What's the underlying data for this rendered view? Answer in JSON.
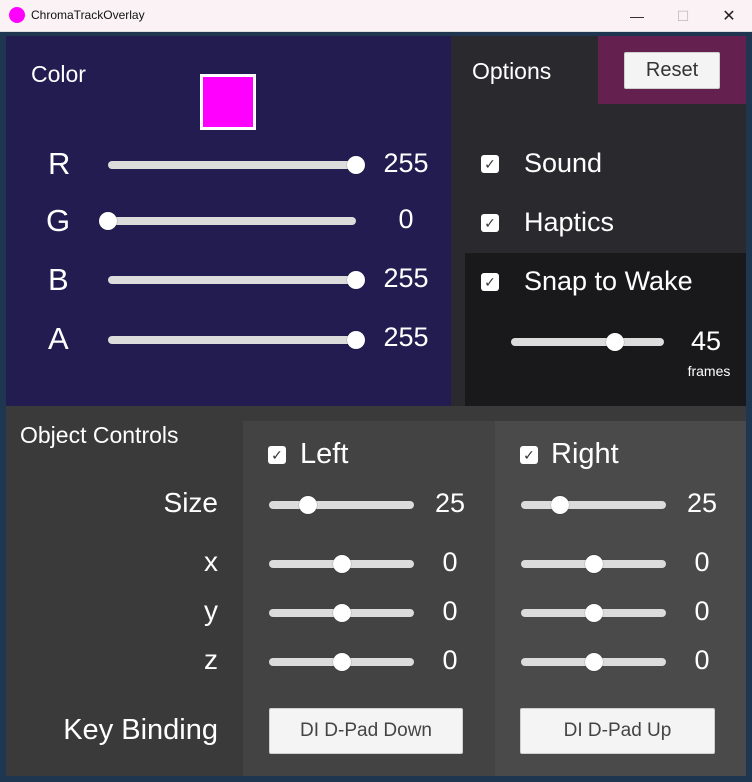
{
  "window": {
    "title": "ChromaTrackOverlay",
    "min_glyph": "—",
    "max_glyph": "☐",
    "close_glyph": "✕",
    "accent": "#ff00ff"
  },
  "color_panel": {
    "heading": "Color",
    "swatch_color": "#ff00ff",
    "channels": [
      {
        "label": "R",
        "value": "255",
        "level": 1.0
      },
      {
        "label": "G",
        "value": "0",
        "level": 0.0
      },
      {
        "label": "B",
        "value": "255",
        "level": 1.0
      },
      {
        "label": "A",
        "value": "255",
        "level": 1.0
      }
    ]
  },
  "options_panel": {
    "heading": "Options",
    "reset_label": "Reset",
    "check_glyph": "✓",
    "sound": {
      "label": "Sound",
      "checked": true
    },
    "haptics": {
      "label": "Haptics",
      "checked": true
    },
    "snap": {
      "label": "Snap to Wake",
      "checked": true,
      "value": "45",
      "unit": "frames",
      "level": 0.68
    }
  },
  "object_controls": {
    "heading": "Object Controls",
    "row_labels": {
      "size": "Size",
      "x": "x",
      "y": "y",
      "z": "z",
      "key_binding": "Key Binding"
    },
    "left": {
      "label": "Left",
      "checked": true,
      "size": {
        "value": "25",
        "level": 0.27
      },
      "x": {
        "value": "0",
        "level": 0.5
      },
      "y": {
        "value": "0",
        "level": 0.5
      },
      "z": {
        "value": "0",
        "level": 0.5
      },
      "binding": "DI D-Pad Down"
    },
    "right": {
      "label": "Right",
      "checked": true,
      "size": {
        "value": "25",
        "level": 0.27
      },
      "x": {
        "value": "0",
        "level": 0.5
      },
      "y": {
        "value": "0",
        "level": 0.5
      },
      "z": {
        "value": "0",
        "level": 0.5
      },
      "binding": "DI D-Pad Up"
    }
  }
}
